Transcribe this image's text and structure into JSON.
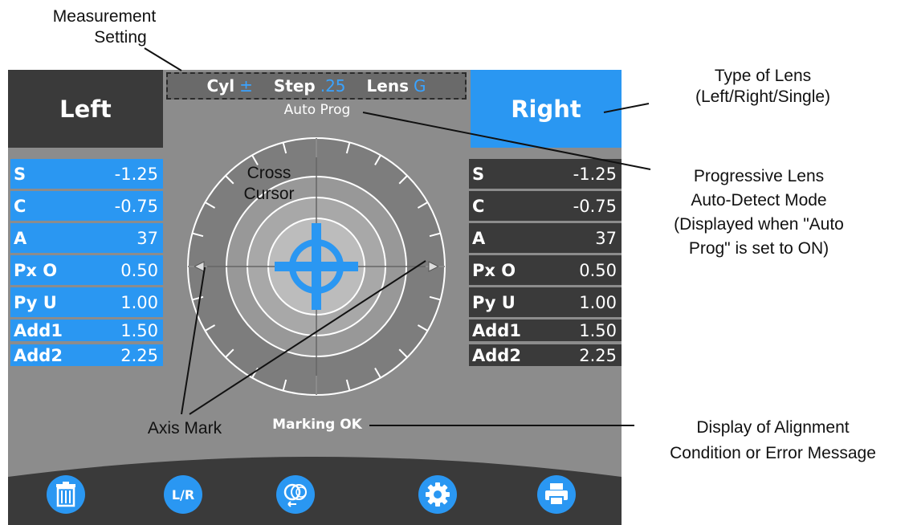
{
  "annotations": {
    "measurement_setting": [
      "Measurement",
      "Setting"
    ],
    "type_of_lens": [
      "Type of Lens",
      "(Left/Right/Single)"
    ],
    "progressive": [
      "Progressive Lens",
      "Auto-Detect Mode",
      "(Displayed when \"Auto",
      "Prog\" is set to ON)"
    ],
    "cross_cursor": [
      "Cross",
      "Cursor"
    ],
    "axis_mark": "Axis Mark",
    "alignment": [
      "Display of Alignment",
      "Condition or Error Message"
    ]
  },
  "screen": {
    "left_label": "Left",
    "right_label": "Right",
    "settings": {
      "cyl_label": "Cyl",
      "cyl_value": "±",
      "step_label": "Step",
      "step_value": ".25",
      "lens_label": "Lens",
      "lens_value": "G"
    },
    "status_top": "Auto Prog",
    "status_bottom": "Marking OK",
    "left_panel": [
      {
        "label": "S",
        "value": "-1.25"
      },
      {
        "label": "C",
        "value": "-0.75"
      },
      {
        "label": "A",
        "value": "37"
      },
      {
        "label": "Px O",
        "value": "0.50"
      },
      {
        "label": "Py U",
        "value": "1.00"
      },
      {
        "label": "Add1",
        "value": "1.50"
      },
      {
        "label": "Add2",
        "value": "2.25"
      }
    ],
    "right_panel": [
      {
        "label": "S",
        "value": "-1.25"
      },
      {
        "label": "C",
        "value": "-0.75"
      },
      {
        "label": "A",
        "value": "37"
      },
      {
        "label": "Px O",
        "value": "0.50"
      },
      {
        "label": "Py U",
        "value": "1.00"
      },
      {
        "label": "Add1",
        "value": "1.50"
      },
      {
        "label": "Add2",
        "value": "2.25"
      }
    ],
    "toolbar": {
      "lr_label": "L/R",
      "icons": [
        "trash-icon",
        "lr-icon",
        "lens-switch-icon",
        "gear-icon",
        "printer-icon"
      ]
    },
    "colors": {
      "accent": "#2a97f2",
      "dark": "#3a3a3a",
      "screen_bg": "#8c8c8c"
    }
  }
}
